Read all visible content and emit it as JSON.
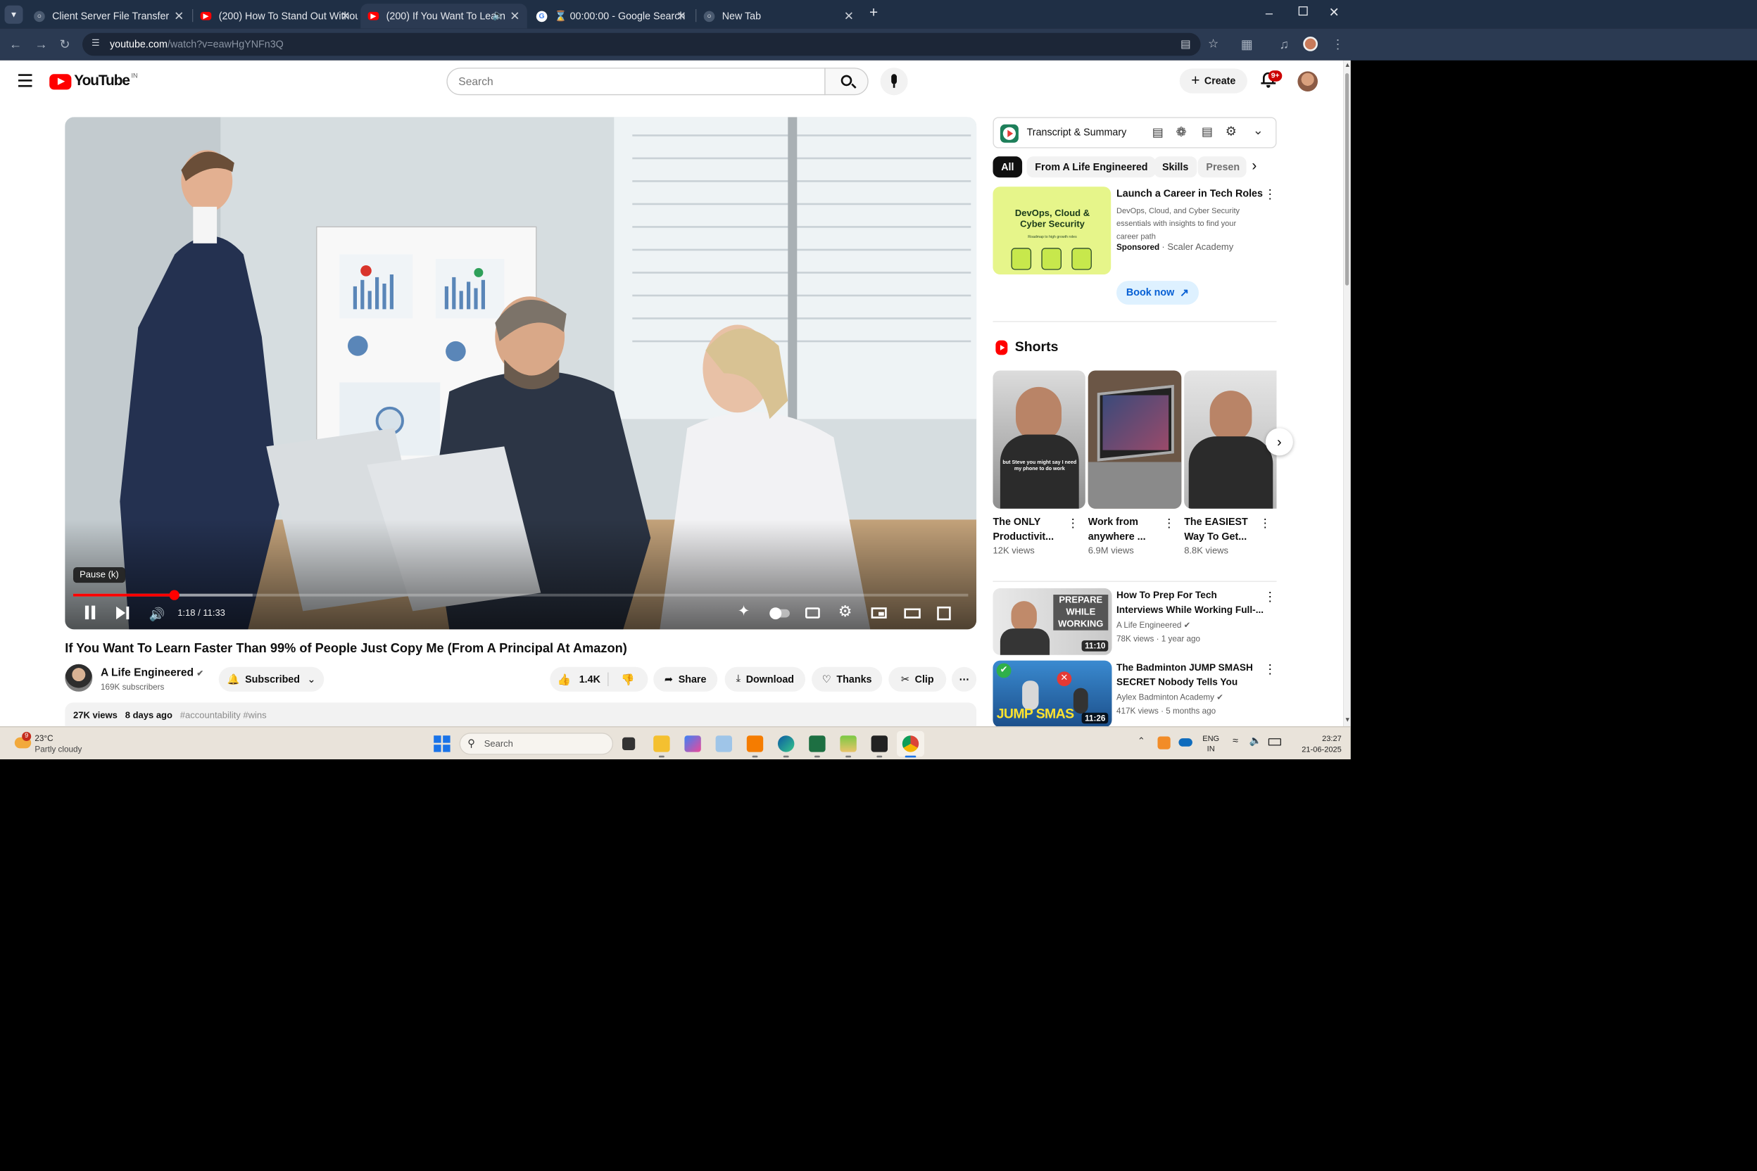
{
  "browser": {
    "tabs": [
      {
        "title": "Client Server File Transfer",
        "active": false
      },
      {
        "title": "(200) How To Stand Out Withou",
        "active": false
      },
      {
        "title": "(200) If You Want To Learn",
        "active": true
      },
      {
        "title": "⌛ 00:00:00 - Google Search",
        "active": false
      },
      {
        "title": "New Tab",
        "active": false
      }
    ],
    "url_domain": "youtube.com",
    "url_path": "/watch?v=eawHgYNFn3Q"
  },
  "youtube": {
    "logo_text": "YouTube",
    "region": "IN",
    "search_placeholder": "Search",
    "create_label": "Create",
    "notifications_badge": "9+"
  },
  "player": {
    "tooltip": "Pause (k)",
    "time": "1:18 / 11:33",
    "progress": 0.1125,
    "buffered": 0.2
  },
  "video": {
    "title": "If You Want To Learn Faster Than 99% of People Just Copy Me (From A Principal At Amazon)",
    "channel": "A Life Engineered",
    "subscribers": "169K subscribers",
    "subscribed_label": "Subscribed",
    "likes": "1.4K",
    "share": "Share",
    "download": "Download",
    "thanks": "Thanks",
    "clip": "Clip",
    "views": "27K views",
    "date": "8 days ago",
    "tags": "#accountability #wins"
  },
  "sidebar": {
    "extension_label": "Transcript & Summary",
    "chips": [
      "All",
      "From A Life Engineered",
      "Skills",
      "Presen"
    ],
    "ad": {
      "image_title": "DevOps, Cloud & Cyber Security",
      "image_subtitle": "Roadmap to high growth roles",
      "title": "Launch a Career in Tech Roles",
      "desc": "DevOps, Cloud, and Cyber Security essentials with insights to find your career path",
      "sponsored": "Sponsored",
      "advertiser": "Scaler Academy",
      "cta": "Book now"
    },
    "shorts_heading": "Shorts",
    "shorts": [
      {
        "title1": "The ONLY",
        "title2": "Productivit...",
        "views": "12K views",
        "caption": "but Steve you might say I need my phone to do work"
      },
      {
        "title1": "Work from",
        "title2": "anywhere ...",
        "views": "6.9M views",
        "caption": ""
      },
      {
        "title1": "The EASIEST",
        "title2": "Way To Get...",
        "views": "8.8K views",
        "caption": ""
      }
    ],
    "videos": [
      {
        "title1": "How To Prep For Tech",
        "title2": "Interviews While Working Full-...",
        "channel": "A Life Engineered",
        "views": "78K views",
        "age": "1 year ago",
        "duration": "11:10",
        "thumb_text": "PREPARE WHILE WORKING"
      },
      {
        "title1": "The Badminton JUMP SMASH",
        "title2": "SECRET Nobody Tells You",
        "channel": "Aylex Badminton Academy",
        "views": "417K views",
        "age": "5 months ago",
        "duration": "11:26",
        "thumb_text": "JUMP SMAS"
      }
    ]
  },
  "taskbar": {
    "temp": "23°C",
    "weather": "Partly cloudy",
    "weather_badge": "9",
    "search": "Search",
    "lang1": "ENG",
    "lang2": "IN",
    "time": "23:27",
    "date": "21-06-2025"
  },
  "colors": {
    "accent": "#ff0000",
    "chrome_dark": "#1f2f45",
    "chip_active": "#0f0f0f"
  }
}
